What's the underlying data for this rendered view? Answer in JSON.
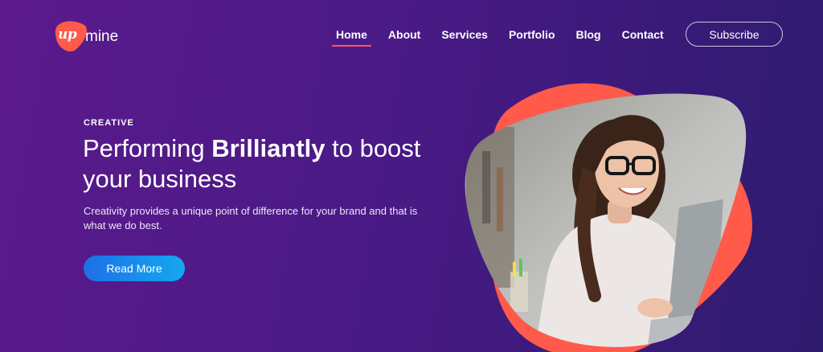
{
  "brand": {
    "logo_mark": "up",
    "logo_word": "mine"
  },
  "nav": {
    "items": [
      {
        "label": "Home",
        "active": true
      },
      {
        "label": "About"
      },
      {
        "label": "Services"
      },
      {
        "label": "Portfolio"
      },
      {
        "label": "Blog"
      },
      {
        "label": "Contact"
      }
    ],
    "subscribe_label": "Subscribe"
  },
  "hero": {
    "eyebrow": "CREATIVE",
    "title_pre": "Performing ",
    "title_bold": "Brilliantly",
    "title_post": " to boost your business",
    "description": "Creativity provides a unique point of difference for your brand and that is what we do best.",
    "cta_label": "Read More"
  },
  "colors": {
    "accent": "#ff5a4a",
    "cta_start": "#1e6fe6",
    "cta_end": "#14a8f0",
    "bg_start": "#5b1a8c",
    "bg_end": "#2d1b6e"
  },
  "image": {
    "subject": "woman-with-glasses-laptop-photo"
  }
}
